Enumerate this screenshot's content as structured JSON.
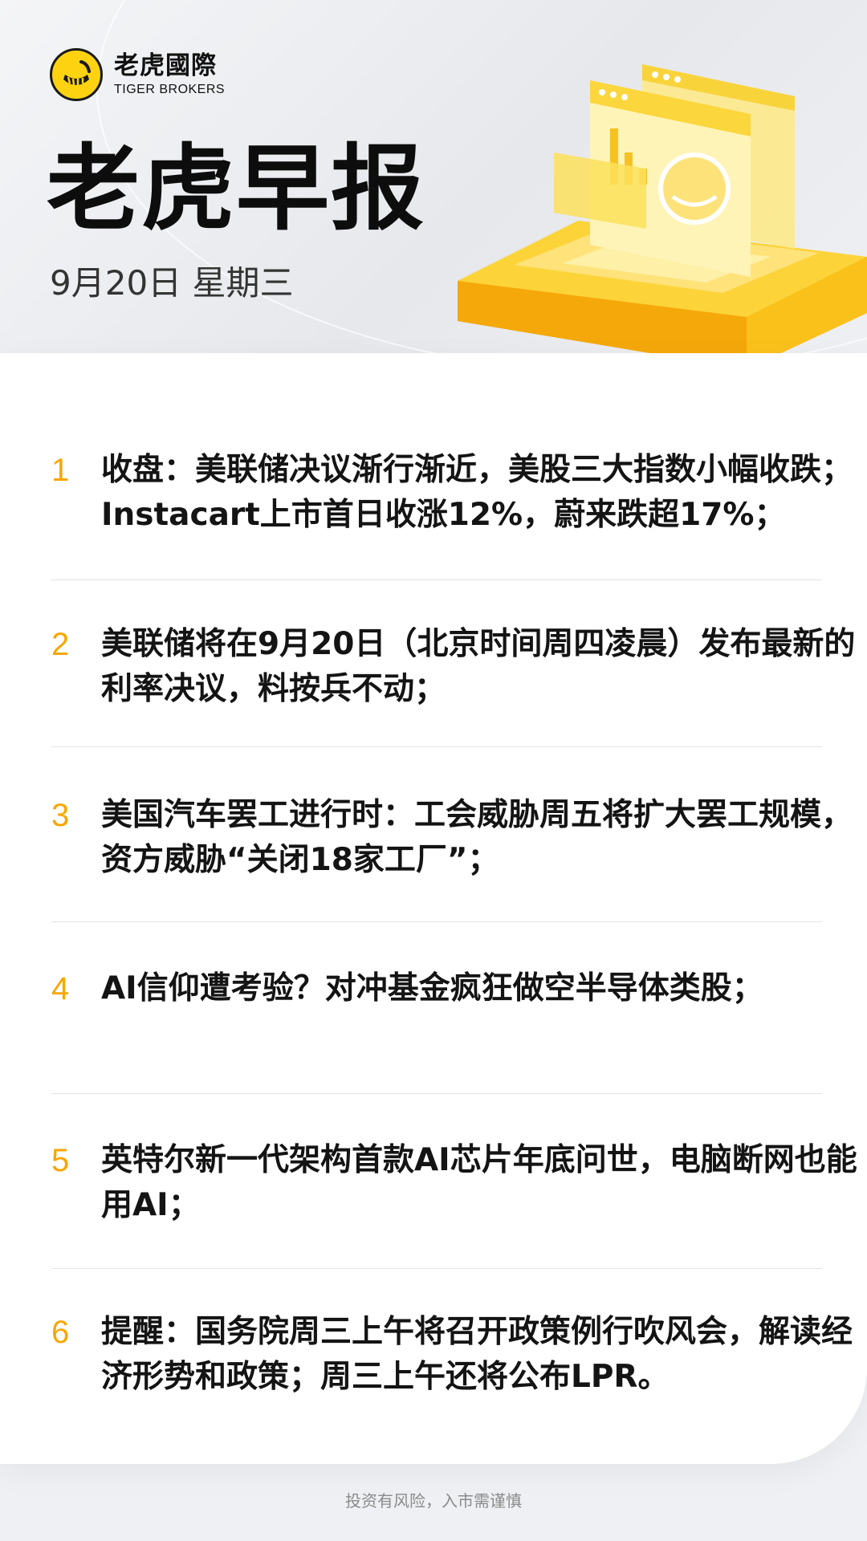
{
  "brand": {
    "name_cn": "老虎國際",
    "name_en": "TIGER BROKERS"
  },
  "header": {
    "title": "老虎早报",
    "date": "9月20日 星期三"
  },
  "items": [
    {
      "number": "1",
      "text": "收盘：美联储决议渐行渐近，美股三大指数小幅收跌；Instacart上市首日收涨12%，蔚来跌超17%；"
    },
    {
      "number": "2",
      "text": "美联储将在9月20日（北京时间周四凌晨）发布最新的利率决议，料按兵不动；"
    },
    {
      "number": "3",
      "text": "美国汽车罢工进行时：工会威胁周五将扩大罢工规模，资方威胁“关闭18家工厂”；"
    },
    {
      "number": "4",
      "text": "AI信仰遭考验？对冲基金疯狂做空半导体类股；"
    },
    {
      "number": "5",
      "text": "英特尔新一代架构首款AI芯片年底问世，电脑断网也能用AI；"
    },
    {
      "number": "6",
      "text": "提醒：国务院周三上午将召开政策例行吹风会，解读经济形势和政策；周三上午还将公布LPR。"
    }
  ],
  "footer": {
    "disclaimer": "投资有风险，入市需谨慎"
  },
  "colors": {
    "accent": "#f7a600",
    "brand_yellow": "#fdd311",
    "text": "#141414"
  }
}
